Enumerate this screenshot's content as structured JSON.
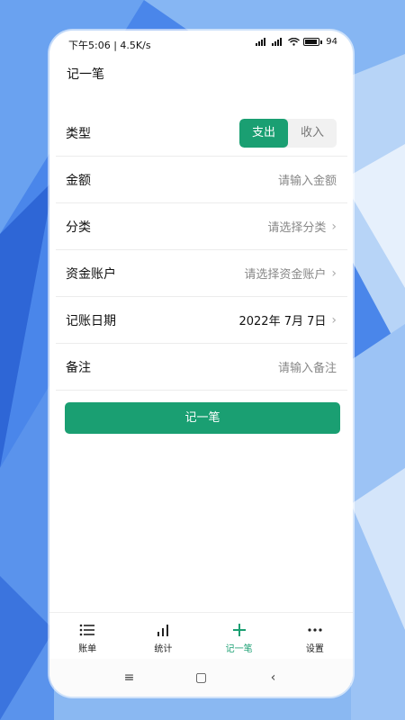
{
  "status_bar": {
    "time": "下午5:06 | 4.5K/s",
    "battery": "94"
  },
  "header": {
    "title": "记一笔"
  },
  "form": {
    "type": {
      "label": "类型",
      "options": [
        "支出",
        "收入"
      ],
      "selected": "支出"
    },
    "amount": {
      "label": "金额",
      "placeholder": "请输入金额"
    },
    "category": {
      "label": "分类",
      "placeholder": "请选择分类"
    },
    "account": {
      "label": "资金账户",
      "placeholder": "请选择资金账户"
    },
    "date": {
      "label": "记账日期",
      "value": "2022年 7月 7日"
    },
    "note": {
      "label": "备注",
      "placeholder": "请输入备注"
    }
  },
  "submit_label": "记一笔",
  "tabs": [
    {
      "label": "账单",
      "icon": "list-icon"
    },
    {
      "label": "统计",
      "icon": "bar-chart-icon"
    },
    {
      "label": "记一笔",
      "icon": "plus-icon"
    },
    {
      "label": "设置",
      "icon": "more-dots-icon"
    }
  ],
  "active_tab": "记一笔",
  "colors": {
    "accent": "#1a9f72",
    "background": "#3d7ae6"
  }
}
